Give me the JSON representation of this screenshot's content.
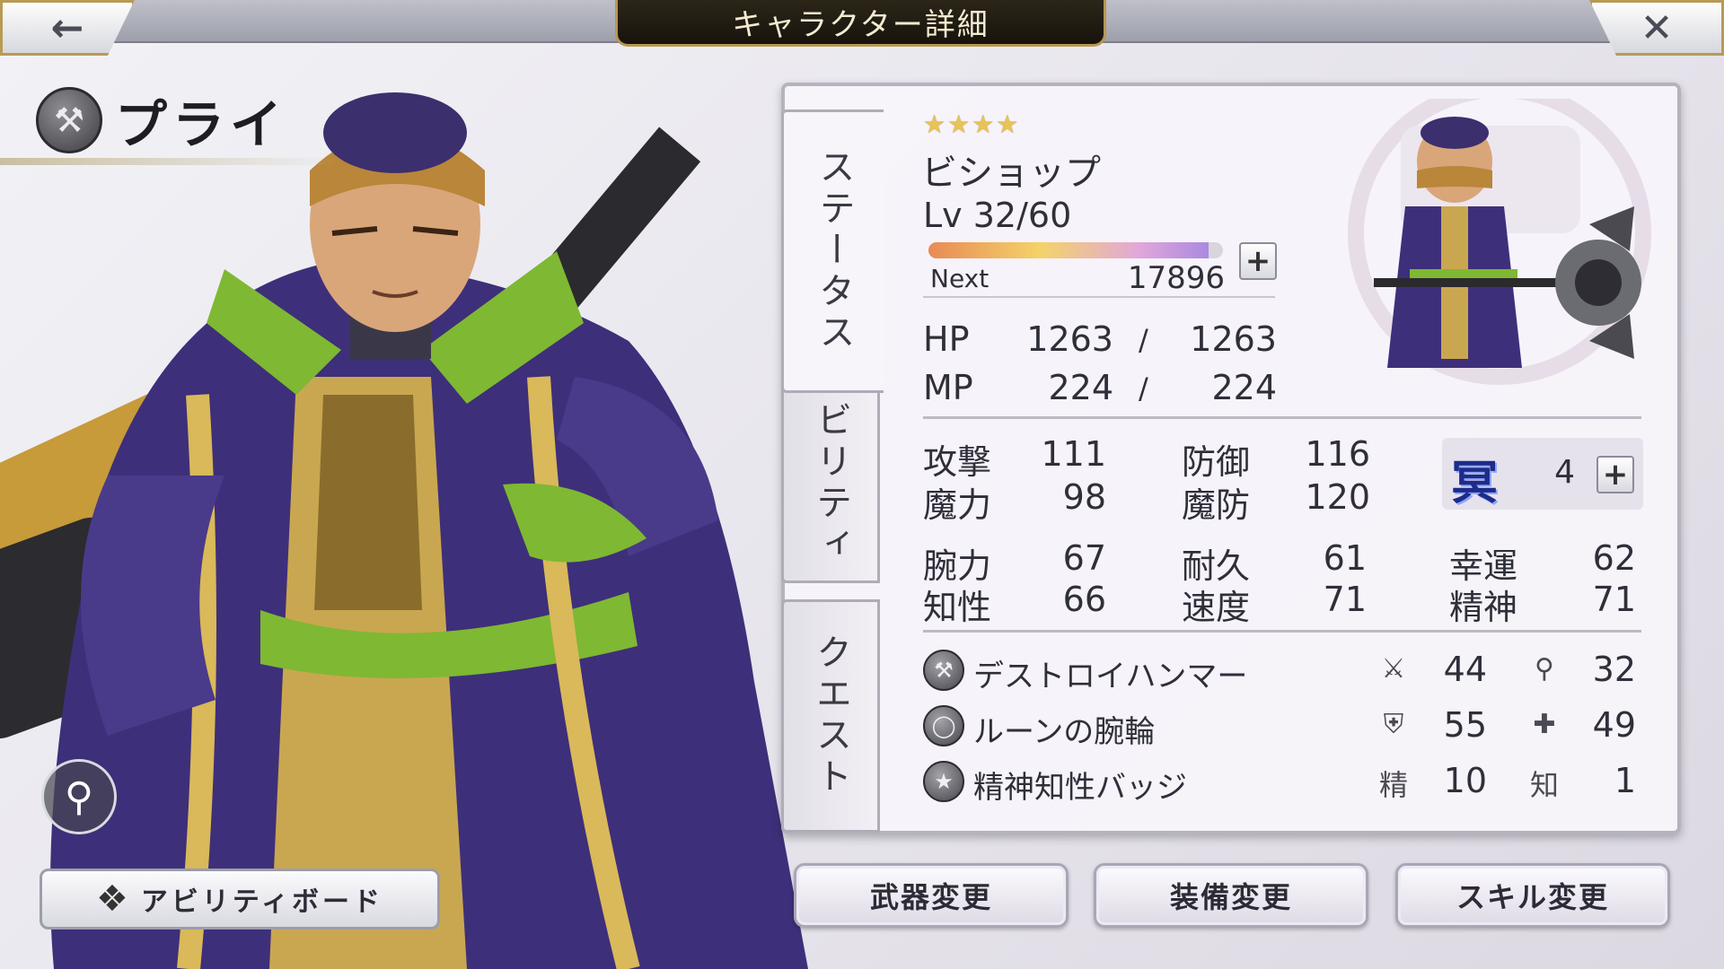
{
  "header": {
    "title": "キャラクター詳細",
    "back_icon": "arrow-left-icon",
    "close_icon": "close-icon"
  },
  "character": {
    "name": "プライ",
    "weapon_type_icon": "hammer-icon"
  },
  "left_controls": {
    "zoom_icon": "magnifier-icon",
    "ability_board_label": "アビリティボード"
  },
  "tabs": [
    {
      "label": "ステータス",
      "active": true
    },
    {
      "label": "アビリティ",
      "active": false
    },
    {
      "label": "クエスト",
      "active": false
    }
  ],
  "status": {
    "stars": "★★★★",
    "star_count": 4,
    "job": "ビショップ",
    "level_text": "Lv 32/60",
    "exp_progress": 0.95,
    "next_label": "Next",
    "next_value": "17896",
    "hp_label": "HP",
    "hp_current": "1263",
    "hp_max": "1263",
    "mp_label": "MP",
    "mp_current": "224",
    "mp_max": "224",
    "slash": "/",
    "atk_label": "攻撃",
    "atk": "111",
    "def_label": "防御",
    "def": "116",
    "mag_label": "魔力",
    "mag": "98",
    "mdef_label": "魔防",
    "mdef": "120",
    "str_label": "腕力",
    "str": "67",
    "end_label": "耐久",
    "end": "61",
    "luck_label": "幸運",
    "luck": "62",
    "int_label": "知性",
    "int": "66",
    "spd_label": "速度",
    "spd": "71",
    "spi_label": "精神",
    "spi": "71",
    "element_label": "冥",
    "element_value": "4"
  },
  "equipment": [
    {
      "name": "デストロイハンマー",
      "icon": "hammer-icon",
      "stat1_icon": "sword-icon",
      "stat1": "44",
      "stat2_icon": "staff-icon",
      "stat2": "32"
    },
    {
      "name": "ルーンの腕輪",
      "icon": "bracelet-icon",
      "stat1_icon": "shield-icon",
      "stat1": "55",
      "stat2_icon": "magic-shield-icon",
      "stat2": "49"
    },
    {
      "name": "精神知性バッジ",
      "icon": "badge-icon",
      "stat1_label": "精",
      "stat1": "10",
      "stat2_label": "知",
      "stat2": "1"
    }
  ],
  "actions": {
    "weapon_change": "武器変更",
    "equip_change": "装備変更",
    "skill_change": "スキル変更"
  },
  "colors": {
    "accent_gold": "#b8974e",
    "robe_purple": "#3e2f7a",
    "collar_green": "#7fb832",
    "element_blue": "#1d2b8a"
  }
}
